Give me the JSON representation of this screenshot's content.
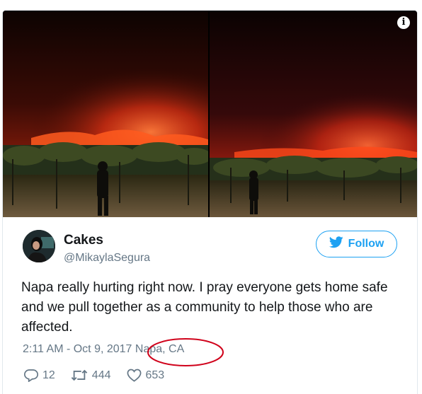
{
  "tweet": {
    "display_name": "Cakes",
    "handle": "@MikaylaSegura",
    "follow_label": "Follow",
    "text": "Napa really hurting right now. I pray everyone gets home safe and we pull together as a community to help those who are affected.",
    "timestamp": "2:11 AM - Oct 9, 2017",
    "location": "Napa, CA",
    "counts": {
      "replies": "12",
      "retweets": "444",
      "likes": "653"
    }
  },
  "media": {
    "info_label": "i",
    "photo_count": 2
  },
  "icons": {
    "info": "info-icon",
    "follow": "twitter-bird-icon",
    "reply": "reply-icon",
    "retweet": "retweet-icon",
    "like": "heart-icon"
  },
  "colors": {
    "accent": "#1da1f2",
    "text": "#14171a",
    "muted": "#657786",
    "annotation": "#d0021b"
  }
}
